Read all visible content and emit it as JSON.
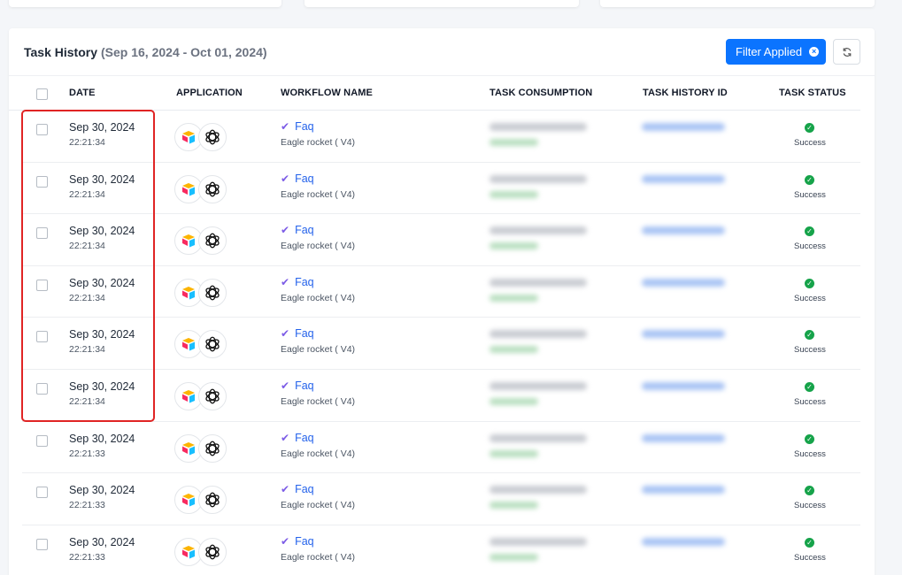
{
  "header": {
    "title": "Task History",
    "date_range": "(Sep 16, 2024 - Oct 01, 2024)",
    "filter_button_label": "Filter Applied"
  },
  "columns": [
    "DATE",
    "APPLICATION",
    "WORKFLOW NAME",
    "TASK CONSUMPTION",
    "TASK HISTORY ID",
    "TASK STATUS"
  ],
  "rows": [
    {
      "date": "Sep 30, 2024",
      "time": "22:21:34",
      "workflow": "Faq",
      "workflow_sub": "Eagle rocket ( V4)",
      "status": "Success"
    },
    {
      "date": "Sep 30, 2024",
      "time": "22:21:34",
      "workflow": "Faq",
      "workflow_sub": "Eagle rocket ( V4)",
      "status": "Success"
    },
    {
      "date": "Sep 30, 2024",
      "time": "22:21:34",
      "workflow": "Faq",
      "workflow_sub": "Eagle rocket ( V4)",
      "status": "Success"
    },
    {
      "date": "Sep 30, 2024",
      "time": "22:21:34",
      "workflow": "Faq",
      "workflow_sub": "Eagle rocket ( V4)",
      "status": "Success"
    },
    {
      "date": "Sep 30, 2024",
      "time": "22:21:34",
      "workflow": "Faq",
      "workflow_sub": "Eagle rocket ( V4)",
      "status": "Success"
    },
    {
      "date": "Sep 30, 2024",
      "time": "22:21:34",
      "workflow": "Faq",
      "workflow_sub": "Eagle rocket ( V4)",
      "status": "Success"
    },
    {
      "date": "Sep 30, 2024",
      "time": "22:21:33",
      "workflow": "Faq",
      "workflow_sub": "Eagle rocket ( V4)",
      "status": "Success"
    },
    {
      "date": "Sep 30, 2024",
      "time": "22:21:33",
      "workflow": "Faq",
      "workflow_sub": "Eagle rocket ( V4)",
      "status": "Success"
    },
    {
      "date": "Sep 30, 2024",
      "time": "22:21:33",
      "workflow": "Faq",
      "workflow_sub": "Eagle rocket ( V4)",
      "status": "Success"
    }
  ],
  "colors": {
    "accent": "#0b74ff",
    "success": "#16a34a",
    "link": "#2563eb",
    "highlight": "#e02424"
  },
  "icons": {
    "app_1": "airtable-icon",
    "app_2": "openai-icon",
    "workflow_check": "check-icon",
    "status": "success-check-icon",
    "refresh": "refresh-icon"
  }
}
